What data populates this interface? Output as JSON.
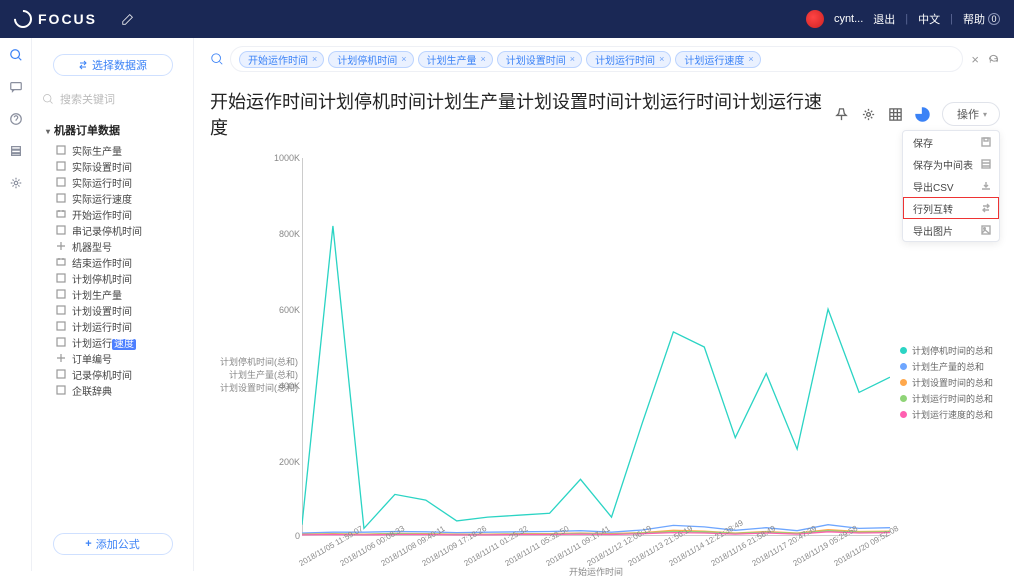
{
  "brand": "FOCUS",
  "header": {
    "username": "cynt...",
    "logout": "退出",
    "lang": "中文",
    "help": "帮助",
    "help_count": "0"
  },
  "sidebar": {
    "select_ds": "选择数据源",
    "search_ph": "搜索关键词",
    "section": "机器订单数据",
    "items": [
      "实际生产量",
      "实际设置时间",
      "实际运行时间",
      "实际运行速度",
      "开始运作时间",
      "串记录停机时间",
      "机器型号",
      "结束运作时间",
      "计划停机时间",
      "计划生产量",
      "计划设置时间",
      "计划运行时间",
      "计划运行",
      "订单编号",
      "记录停机时间",
      "企联辞典"
    ],
    "item12_hl": "速度",
    "add_formula": "添加公式"
  },
  "query": {
    "chips": [
      "开始运作时间",
      "计划停机时间",
      "计划生产量",
      "计划设置时间",
      "计划运行时间",
      "计划运行速度"
    ]
  },
  "title": "开始运作时间计划停机时间计划生产量计划设置时间计划运行时间计划运行速度",
  "op_label": "操作",
  "menu": {
    "save": "保存",
    "save_inter": "保存为中间表",
    "export_csv": "导出CSV",
    "transpose": "行列互转",
    "export_img": "导出图片"
  },
  "yticks": {
    "t1000": "1000K",
    "t800": "800K",
    "t600": "600K",
    "t400": "400K",
    "t200": "200K",
    "t0": "0"
  },
  "y_measures": [
    "计划停机时间(总和)",
    "计划生产量(总和)",
    "计划设置时间(总和)"
  ],
  "xlabel": "开始运作时间",
  "legend": {
    "s1": "计划停机时间的总和",
    "s2": "计划生产量的总和",
    "s3": "计划设置时间的总和",
    "s4": "计划运行时间的总和",
    "s5": "计划运行速度的总和"
  },
  "xt": {
    "x0": "2018/11/05 11:59:07",
    "x1": "2018/11/06 00:08:33",
    "x2": "2018/11/08 09:40:11",
    "x3": "2018/11/09 17:18:26",
    "x4": "2018/11/11 01:25:32",
    "x5": "2018/11/11 05:32:50",
    "x6": "2018/11/11 09:17:41",
    "x7": "2018/11/12 12:06:19",
    "x8": "2018/11/13 21:56:19",
    "x9": "2018/11/14 12:21:38:49",
    "x10": "2018/11/16 21:58:49",
    "x11": "2018/11/17 20:47:39",
    "x12": "2018/11/19 05:29:58",
    "x13": "2018/11/20 09:52:08"
  },
  "colors": {
    "s1": "#2bd4c4",
    "s2": "#6ea6ff",
    "s3": "#ffa84c",
    "s4": "#8fd477",
    "s5": "#ff5fb0"
  },
  "chart_data": {
    "type": "line",
    "title": "开始运作时间计划停机时间计划生产量计划设置时间计划运行时间计划运行速度",
    "xlabel": "开始运作时间",
    "ylim": [
      0,
      1000
    ],
    "y_unit": "K",
    "categories": [
      "2018/11/05 11:59:07",
      "2018/11/06 00:08:33",
      "2018/11/08 09:40:11",
      "2018/11/09 17:18:26",
      "2018/11/11 01:25:32",
      "2018/11/11 05:32:50",
      "2018/11/11 09:17:41",
      "2018/11/12 12:06:19",
      "2018/11/13 21:56:19",
      "2018/11/14 12:21:38",
      "2018/11/16 21:58:49",
      "2018/11/17 20:47:39",
      "2018/11/19 05:29:58",
      "2018/11/20 09:52:08"
    ],
    "series": [
      {
        "name": "计划停机时间的总和",
        "color": "#2bd4c4",
        "values": [
          30,
          820,
          20,
          110,
          95,
          40,
          50,
          55,
          60,
          150,
          50,
          300,
          540,
          500,
          260,
          430,
          230,
          600,
          380,
          420
        ]
      },
      {
        "name": "计划生产量的总和",
        "color": "#6ea6ff",
        "values": [
          8,
          10,
          10,
          12,
          11,
          9,
          10,
          11,
          12,
          14,
          10,
          16,
          28,
          24,
          15,
          22,
          14,
          30,
          20,
          22
        ]
      },
      {
        "name": "计划设置时间的总和",
        "color": "#ffa84c",
        "values": [
          5,
          6,
          5,
          7,
          6,
          5,
          5,
          6,
          6,
          8,
          6,
          9,
          15,
          13,
          8,
          12,
          8,
          17,
          12,
          13
        ]
      },
      {
        "name": "计划运行时间的总和",
        "color": "#8fd477",
        "values": [
          4,
          5,
          4,
          6,
          5,
          4,
          4,
          5,
          5,
          7,
          5,
          8,
          12,
          11,
          7,
          10,
          7,
          14,
          10,
          11
        ]
      },
      {
        "name": "计划运行速度的总和",
        "color": "#ff5fb0",
        "values": [
          3,
          4,
          3,
          4,
          4,
          3,
          3,
          4,
          4,
          5,
          4,
          6,
          9,
          8,
          5,
          8,
          5,
          11,
          8,
          9
        ]
      }
    ]
  }
}
